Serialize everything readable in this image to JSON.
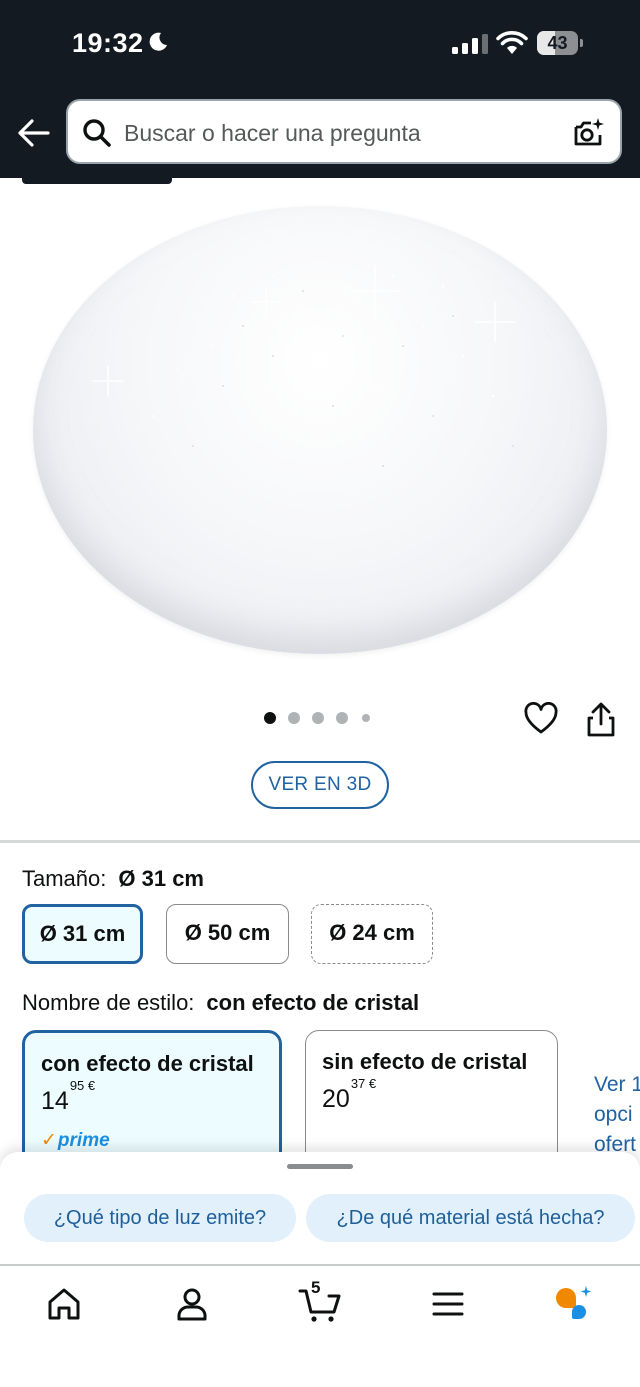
{
  "status_bar": {
    "time": "19:32",
    "battery": "43",
    "battery_level": 0.43
  },
  "header": {
    "search_placeholder": "Buscar o hacer una pregunta"
  },
  "gallery": {
    "image_count": 5,
    "active_index": 0,
    "view_3d_label": "VER EN 3D"
  },
  "size": {
    "label": "Tamaño:",
    "selected": "Ø 31 cm",
    "options": [
      "Ø 31 cm",
      "Ø 50 cm",
      "Ø 24 cm"
    ]
  },
  "style": {
    "label": "Nombre de estilo:",
    "selected": "con efecto de cristal",
    "options": [
      {
        "name": "con efecto de cristal",
        "price_whole": "14",
        "price_fraction": "95",
        "currency": "€",
        "prime": "prime"
      },
      {
        "name": "sin efecto de cristal",
        "price_whole": "20",
        "price_fraction": "37",
        "currency": "€"
      }
    ],
    "more_options": [
      "Ver 1",
      "opci",
      "ofert"
    ]
  },
  "suggestions": [
    "¿Qué tipo de luz emite?",
    "¿De qué material está hecha?"
  ],
  "nav": {
    "cart_count": "5"
  },
  "colors": {
    "header_bg": "#131a22",
    "link_blue": "#2162a1",
    "selected_bg": "#edfdff",
    "prime_blue": "#1a8fe3",
    "rufus_orange": "#f08804",
    "rufus_blue": "#1a8fe3"
  }
}
